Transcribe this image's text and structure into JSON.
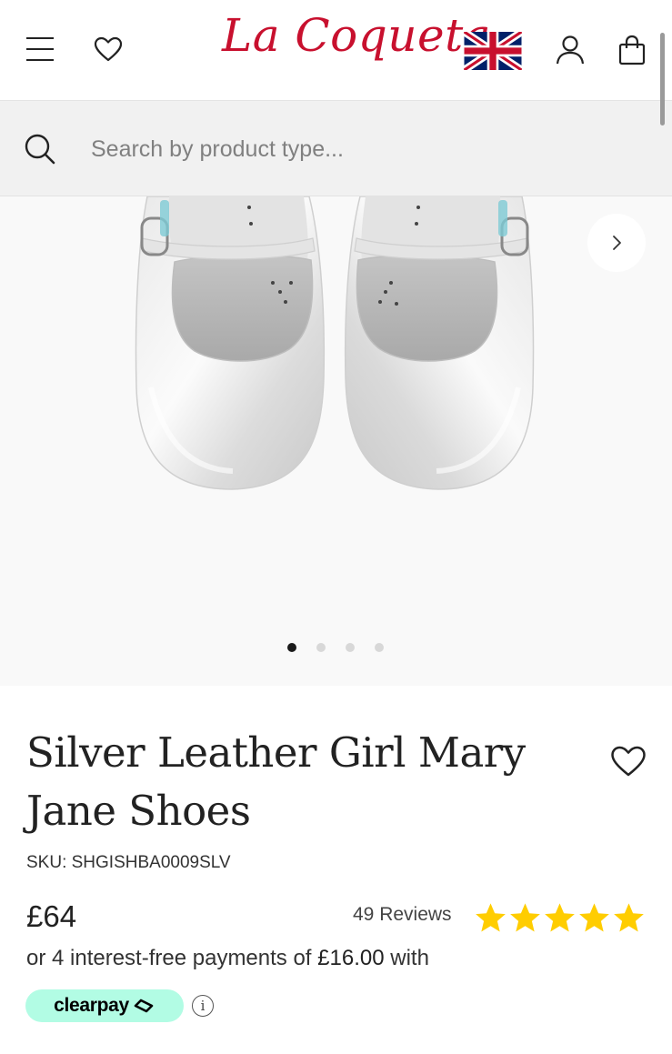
{
  "header": {
    "logo_text": "La Coqueta",
    "menu_icon": "menu-icon",
    "wishlist_icon": "heart-icon",
    "flag_icon": "uk-flag-icon",
    "account_icon": "user-icon",
    "bag_icon": "shopping-bag-icon"
  },
  "search": {
    "placeholder": "Search by product type...",
    "value": "",
    "icon": "search-icon"
  },
  "gallery": {
    "image_alt": "silver leather mary jane shoes",
    "next_icon": "chevron-right-icon",
    "slide_count": 4,
    "active_slide": 1
  },
  "product": {
    "title": "Silver Leather Girl Mary Jane Shoes",
    "sku": "SKU: SHGISHBA0009SLV",
    "price": "£64",
    "reviews_label": "49 Reviews",
    "rating": 5,
    "rating_max": 5,
    "installment_prefix": "or 4 interest-free payments of ",
    "installment_amount": "£16.00",
    "installment_suffix": " with",
    "clearpay_label": "clearpay",
    "info_glyph": "i"
  },
  "colors": {
    "brand": "#c8102e",
    "star": "#ffcd00",
    "clearpay_bg": "#b2fce4",
    "dot_active": "#1a1a1a",
    "dot_inactive": "#d8d8d8"
  }
}
